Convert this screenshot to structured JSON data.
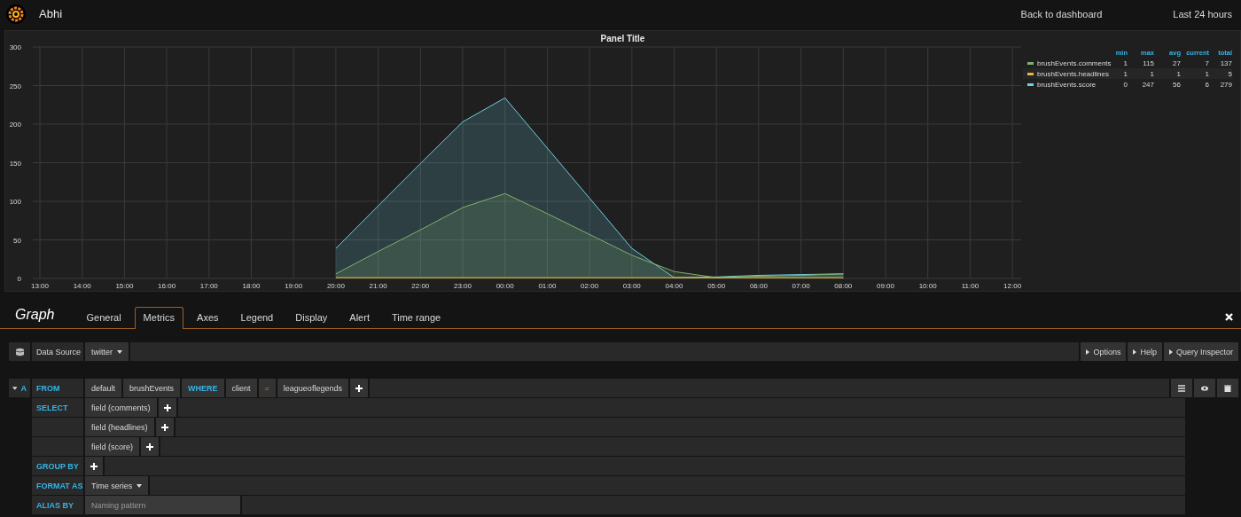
{
  "topbar": {
    "title": "Abhi",
    "links": [
      "Back to dashboard",
      "Last 24 hours"
    ]
  },
  "panel": {
    "title": "Panel Title",
    "chart_data": {
      "type": "area",
      "categories": [
        "13:00",
        "14:00",
        "15:00",
        "16:00",
        "17:00",
        "18:00",
        "19:00",
        "20:00",
        "21:00",
        "22:00",
        "23:00",
        "00:00",
        "01:00",
        "02:00",
        "03:00",
        "04:00",
        "05:00",
        "06:00",
        "07:00",
        "08:00",
        "09:00",
        "10:00",
        "11:00",
        "12:00"
      ],
      "series": [
        {
          "color": "#7eb26d",
          "values": [
            null,
            null,
            null,
            null,
            null,
            null,
            null,
            6,
            35,
            63,
            92,
            110,
            84,
            57,
            30,
            9,
            1,
            3,
            4,
            6,
            null,
            null,
            null,
            null
          ]
        },
        {
          "color": "#eab839",
          "values": [
            null,
            null,
            null,
            null,
            null,
            null,
            null,
            1,
            1,
            1,
            1,
            1,
            1,
            1,
            1,
            1,
            1,
            1,
            1,
            1,
            null,
            null,
            null,
            null
          ]
        },
        {
          "color": "#6ed0e0",
          "values": [
            null,
            null,
            null,
            null,
            null,
            null,
            null,
            39,
            94,
            149,
            203,
            234,
            169,
            104,
            39,
            1,
            2,
            4,
            5,
            6,
            null,
            null,
            null,
            null
          ]
        }
      ],
      "ylim": [
        0,
        300
      ],
      "grid": true,
      "yticks": [
        0,
        50,
        100,
        150,
        200,
        250,
        300
      ]
    },
    "legend": {
      "columns": [
        "min",
        "max",
        "avg",
        "current",
        "total"
      ],
      "rows": [
        {
          "name": "brushEvents.comments",
          "color": "#7eb26d",
          "values": [
            "1",
            "115",
            "27",
            "7",
            "137"
          ]
        },
        {
          "name": "brushEvents.headlines",
          "color": "#eab839",
          "values": [
            "1",
            "1",
            "1",
            "1",
            "5"
          ]
        },
        {
          "name": "brushEvents.score",
          "color": "#6ed0e0",
          "values": [
            "0",
            "247",
            "56",
            "6",
            "279"
          ]
        }
      ]
    }
  },
  "editor": {
    "title": "Graph",
    "tabs": [
      {
        "label": "General",
        "selected": false
      },
      {
        "label": "Metrics",
        "selected": true
      },
      {
        "label": "Axes",
        "selected": false
      },
      {
        "label": "Legend",
        "selected": false
      },
      {
        "label": "Display",
        "selected": false
      },
      {
        "label": "Alert",
        "selected": false
      },
      {
        "label": "Time range",
        "selected": false
      }
    ],
    "datasource": {
      "label": "Data Source",
      "value": "twitter",
      "buttons": [
        "Options",
        "Help",
        "Query Inspector"
      ]
    },
    "query": {
      "ref": "A",
      "rows": [
        {
          "label": "FROM",
          "items": [
            {
              "kind": "segment",
              "text": "default"
            },
            {
              "kind": "segment",
              "text": "brushEvents"
            },
            {
              "kind": "keyword",
              "text": "WHERE"
            },
            {
              "kind": "segment",
              "text": "client"
            },
            {
              "kind": "operator",
              "text": "="
            },
            {
              "kind": "segment",
              "text": "leagueoflegends"
            },
            {
              "kind": "plus"
            }
          ]
        },
        {
          "label": "SELECT",
          "items": [
            {
              "kind": "segment",
              "text": "field (comments)"
            },
            {
              "kind": "plus"
            }
          ]
        },
        {
          "items": [
            {
              "kind": "segment",
              "text": "field (headlines)"
            },
            {
              "kind": "plus"
            }
          ]
        },
        {
          "items": [
            {
              "kind": "segment",
              "text": "field (score)"
            },
            {
              "kind": "plus"
            }
          ]
        },
        {
          "label": "GROUP BY",
          "items": [
            {
              "kind": "plus"
            }
          ]
        },
        {
          "label": "FORMAT AS",
          "items": [
            {
              "kind": "dropdown",
              "text": "Time series"
            }
          ]
        },
        {
          "label": "ALIAS BY",
          "items": [
            {
              "kind": "input",
              "placeholder": "Naming pattern"
            }
          ]
        }
      ]
    }
  }
}
